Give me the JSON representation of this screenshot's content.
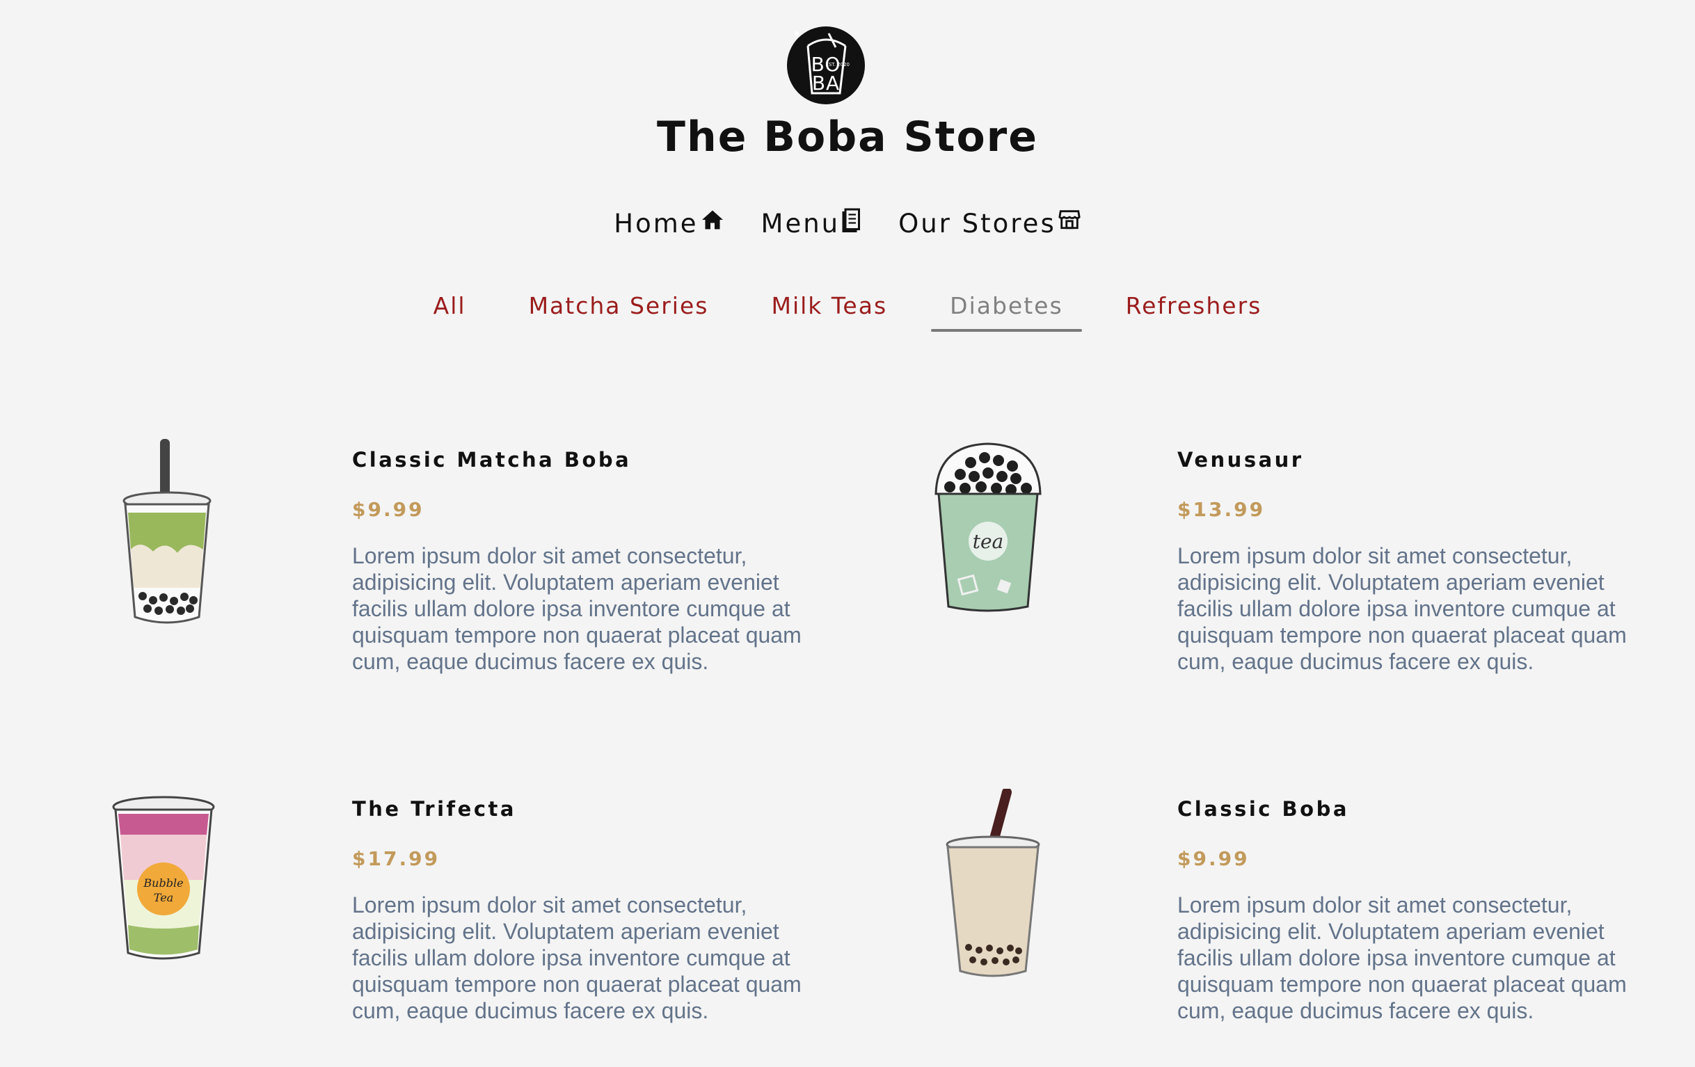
{
  "header": {
    "logo": {
      "icon": "boba-cup-logo",
      "line1": "BO",
      "line2": "BA",
      "est": "EST. 2020"
    },
    "title": "The Boba Store"
  },
  "nav": [
    {
      "label": "Home",
      "icon": "home-icon"
    },
    {
      "label": "Menu",
      "icon": "menu-book-icon"
    },
    {
      "label": "Our Stores",
      "icon": "store-icon"
    }
  ],
  "tabs": [
    {
      "label": "All",
      "active": false
    },
    {
      "label": "Matcha Series",
      "active": false
    },
    {
      "label": "Milk Teas",
      "active": false
    },
    {
      "label": "Diabetes",
      "active": true
    },
    {
      "label": "Refreshers",
      "active": false
    }
  ],
  "colors": {
    "background": "#f4f4f4",
    "tab": "#9b1c1c",
    "tab_active": "#808080",
    "price": "#c29a5b",
    "description": "#62738a"
  },
  "menu": [
    {
      "name": "Classic Matcha Boba",
      "price": "$9.99",
      "image": "matcha-boba-cup",
      "description": "Lorem ipsum dolor sit amet consectetur, adipisicing elit. Voluptatem aperiam eveniet facilis ullam dolore ipsa inventore cumque at quisquam tempore non quaerat placeat quam cum, eaque ducimus facere ex quis."
    },
    {
      "name": "Venusaur",
      "price": "$13.99",
      "image": "green-tea-dome-cup",
      "description": "Lorem ipsum dolor sit amet consectetur, adipisicing elit. Voluptatem aperiam eveniet facilis ullam dolore ipsa inventore cumque at quisquam tempore non quaerat placeat quam cum, eaque ducimus facere ex quis."
    },
    {
      "name": "The Trifecta",
      "price": "$17.99",
      "image": "bubble-tea-layered-cup",
      "description": "Lorem ipsum dolor sit amet consectetur, adipisicing elit. Voluptatem aperiam eveniet facilis ullam dolore ipsa inventore cumque at quisquam tempore non quaerat placeat quam cum, eaque ducimus facere ex quis.",
      "cup_label": "Bubble Tea"
    },
    {
      "name": "Classic Boba",
      "price": "$9.99",
      "image": "classic-milk-tea-cup",
      "description": "Lorem ipsum dolor sit amet consectetur, adipisicing elit. Voluptatem aperiam eveniet facilis ullam dolore ipsa inventore cumque at quisquam tempore non quaerat placeat quam cum, eaque ducimus facere ex quis."
    }
  ]
}
